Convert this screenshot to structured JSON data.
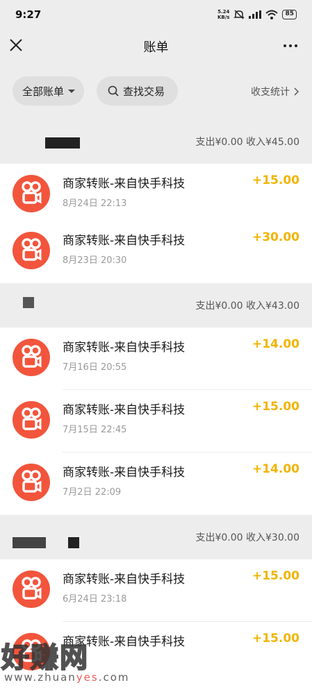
{
  "status_bar": {
    "time": "9:27",
    "net_speed_value": "5.24",
    "net_speed_unit": "KB/s",
    "battery": "85"
  },
  "nav": {
    "title": "账单"
  },
  "filters": {
    "all_bills": "全部账单",
    "search": "查找交易",
    "stats": "收支统计"
  },
  "sections": [
    {
      "summary": "支出¥0.00  收入¥45.00",
      "rows": [
        {
          "title": "商家转账-来自快手科技",
          "date": "8月24日 22:13",
          "amount": "+15.00"
        },
        {
          "title": "商家转账-来自快手科技",
          "date": "8月23日 20:30",
          "amount": "+30.00"
        }
      ]
    },
    {
      "summary": "支出¥0.00  收入¥43.00",
      "rows": [
        {
          "title": "商家转账-来自快手科技",
          "date": "7月16日 20:55",
          "amount": "+14.00"
        },
        {
          "title": "商家转账-来自快手科技",
          "date": "7月15日 22:45",
          "amount": "+15.00"
        },
        {
          "title": "商家转账-来自快手科技",
          "date": "7月2日 22:09",
          "amount": "+14.00"
        }
      ]
    },
    {
      "summary": "支出¥0.00  收入¥30.00",
      "rows": [
        {
          "title": "商家转账-来自快手科技",
          "date": "6月24日 23:18",
          "amount": "+15.00"
        },
        {
          "title": "商家转账-来自快手科技",
          "date": "",
          "amount": "+15.00"
        }
      ]
    }
  ],
  "watermark": {
    "big": "好赚网",
    "small_a": "www.zhuan",
    "small_b": "yes",
    "small_c": ".com"
  },
  "colors": {
    "income": "#f0b400",
    "icon_bg": "#f2553c"
  },
  "icons": {
    "close": "close-icon",
    "more": "more-icon",
    "search": "search-icon",
    "chevron": "chevron-right-icon",
    "app": "kuaishou-icon"
  }
}
